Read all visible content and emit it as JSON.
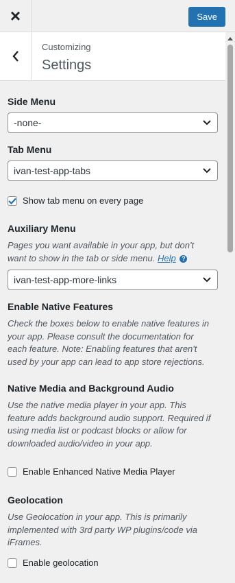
{
  "topbar": {
    "close_icon": "×",
    "save_label": "Save"
  },
  "header": {
    "crumb": "Customizing",
    "title": "Settings"
  },
  "side_menu": {
    "title": "Side Menu",
    "value": "-none-"
  },
  "tab_menu": {
    "title": "Tab Menu",
    "value": "ivan-test-app-tabs",
    "show_every_page_label": "Show tab menu on every page",
    "show_every_page_checked": true
  },
  "aux_menu": {
    "title": "Auxiliary Menu",
    "desc": "Pages you want available in your app, but don't want to show in the tab or side menu.",
    "help_label": "Help",
    "value": "ivan-test-app-more-links"
  },
  "native_features": {
    "title": "Enable Native Features",
    "desc": "Check the boxes below to enable native features in your app. Please consult the documentation for each feature. Note: Enabling features that aren't used by your app can lead to app store rejections."
  },
  "media": {
    "title": "Native Media and Background Audio",
    "desc": "Use the native media player in your app. This feature adds background audio support. Required if using media list or podcast blocks or allow for downloaded audio/video in your app.",
    "checkbox_label": "Enable Enhanced Native Media Player",
    "checked": false
  },
  "geo": {
    "title": "Geolocation",
    "desc": "Use Geolocation in your app. This is primarily implemented with 3rd party WP plugins/code via iFrames.",
    "checkbox_label": "Enable geolocation",
    "checked": false
  },
  "colors": {
    "accent": "#2271b1",
    "background": "#f0f0f1"
  }
}
